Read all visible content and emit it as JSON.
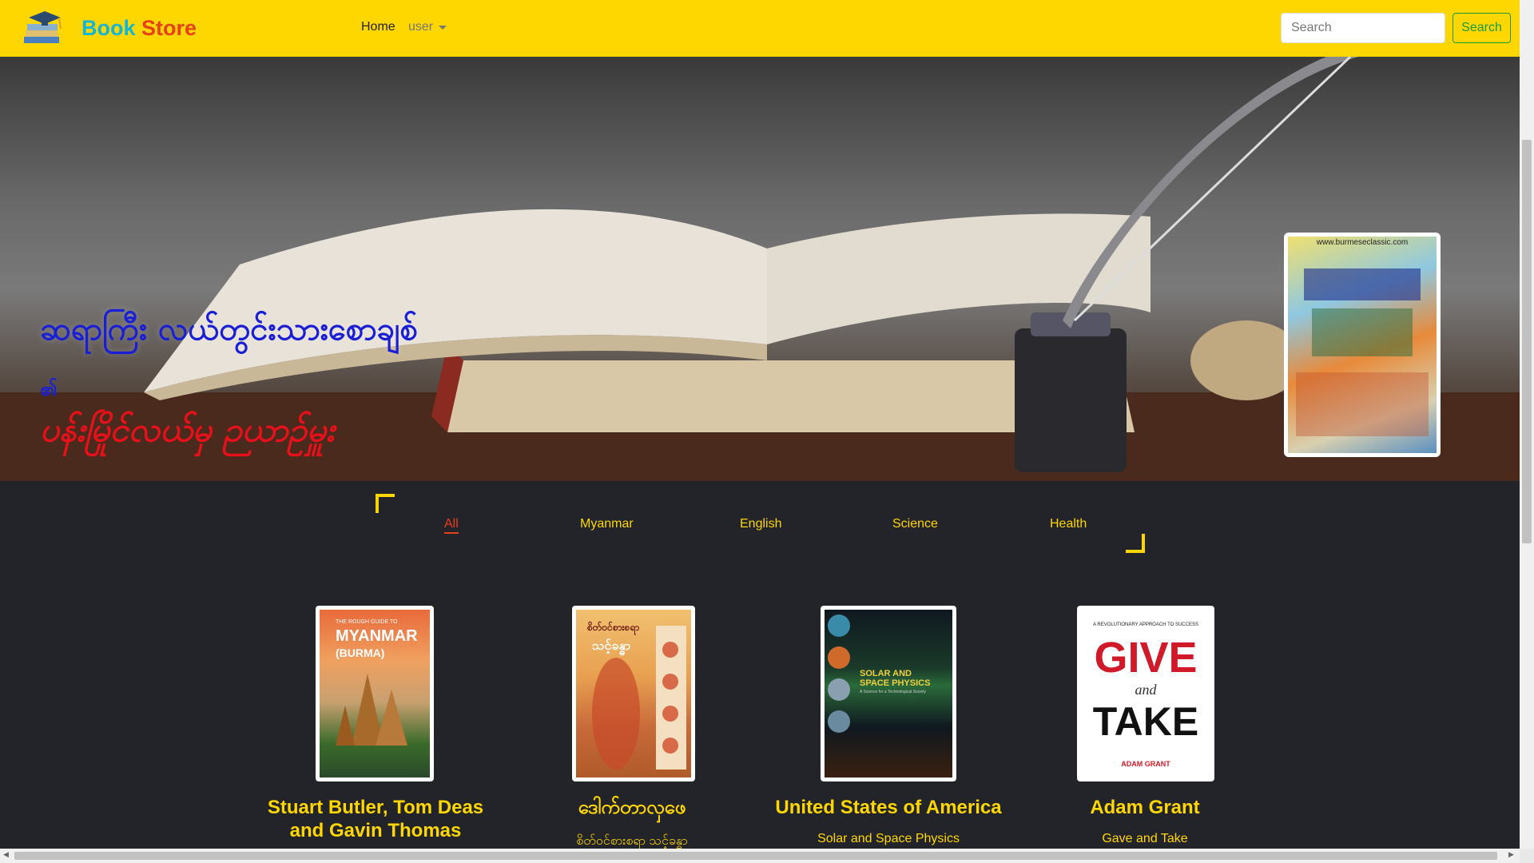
{
  "brand": {
    "book": "Book",
    "store": "Store"
  },
  "nav": {
    "home": "Home",
    "user": "user"
  },
  "search": {
    "placeholder": "Search",
    "button": "Search"
  },
  "hero": {
    "line1": "ဆရာကြီး လယ်တွင်းသားစောချစ်",
    "line2": "၏",
    "line3": "ပန်းမြိုင်လယ်မှ ဉယာဉ်မှူး",
    "cover_url": "www.burmeseclassic.com"
  },
  "tabs": [
    "All",
    "Myanmar",
    "English",
    "Science",
    "Health"
  ],
  "active_tab": "All",
  "books": [
    {
      "author": "Stuart Butler, Tom Deas and Gavin Thomas",
      "title": "",
      "cover_text": [
        "THE ROUGH GUIDE TO",
        "MYANMAR",
        "(BURMA)"
      ]
    },
    {
      "author": "ဒေါက်တာလှဖေ",
      "title": "စိတ်ဝင်စားစရာ သင့်ခန္ဓာ",
      "cover_text": [
        "စိတ်ဝင်စားစရာ",
        "သင့်ခန္ဓာ"
      ]
    },
    {
      "author": "United States of America",
      "title": "Solar and Space Physics",
      "cover_text": [
        "SOLAR AND",
        "SPACE PHYSICS",
        "A Science for a Technological Society"
      ]
    },
    {
      "author": "Adam Grant",
      "title": "Gave and Take",
      "cover_text": [
        "A REVOLUTIONARY APPROACH TO SUCCESS",
        "GIVE",
        "and",
        "TAKE",
        "ADAM GRANT"
      ]
    }
  ],
  "colors": {
    "navbar": "#ffd700",
    "accent": "#ffd700",
    "active": "#e8401a",
    "background": "#22242a"
  }
}
